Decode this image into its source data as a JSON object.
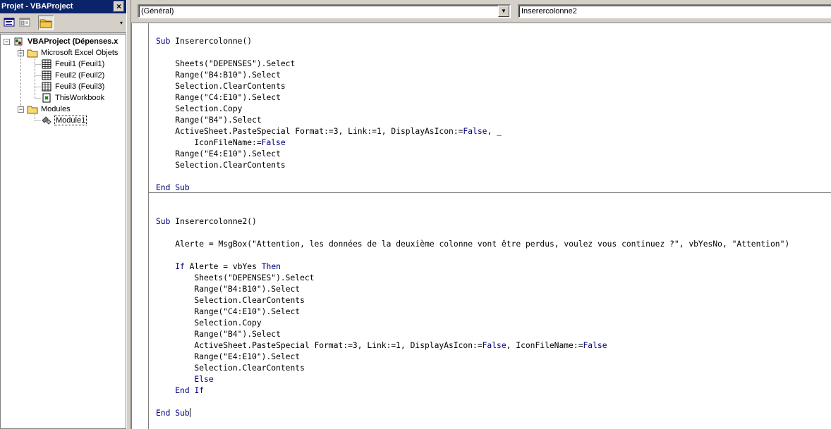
{
  "project_panel": {
    "title": "Projet - VBAProject",
    "close_glyph": "×",
    "toolbar": {
      "view_code_icon": "view-code-icon",
      "view_object_icon": "view-object-icon",
      "toggle_folders_icon": "folder-icon"
    },
    "tree": {
      "root": "VBAProject (Dépenses.x",
      "folders": [
        {
          "label": "Microsoft Excel Objets",
          "items": [
            "Feuil1 (Feuil1)",
            "Feuil2 (Feuil2)",
            "Feuil3 (Feuil3)",
            "ThisWorkbook"
          ]
        },
        {
          "label": "Modules",
          "items": [
            "Module1"
          ]
        }
      ]
    }
  },
  "code_window": {
    "object_combo": "(Général)",
    "procedure_combo": "Inserercolonne2",
    "lines": [
      "Sub Inserercolonne()",
      "",
      "    Sheets(\"DEPENSES\").Select",
      "    Range(\"B4:B10\").Select",
      "    Selection.ClearContents",
      "    Range(\"C4:E10\").Select",
      "    Selection.Copy",
      "    Range(\"B4\").Select",
      "    ActiveSheet.PasteSpecial Format:=3, Link:=1, DisplayAsIcon:=False, _",
      "        IconFileName:=False",
      "    Range(\"E4:E10\").Select",
      "    Selection.ClearContents",
      "",
      "End Sub",
      "",
      "",
      "Sub Inserercolonne2()",
      "",
      "    Alerte = MsgBox(\"Attention, les données de la deuxième colonne vont être perdus, voulez vous continuez ?\", vbYesNo, \"Attention\")",
      "",
      "    If Alerte = vbYes Then",
      "        Sheets(\"DEPENSES\").Select",
      "        Range(\"B4:B10\").Select",
      "        Selection.ClearContents",
      "        Range(\"C4:E10\").Select",
      "        Selection.Copy",
      "        Range(\"B4\").Select",
      "        ActiveSheet.PasteSpecial Format:=3, Link:=1, DisplayAsIcon:=False, IconFileName:=False",
      "        Range(\"E4:E10\").Select",
      "        Selection.ClearContents",
      "        Else",
      "    End If",
      "",
      "End Sub"
    ],
    "keywords": [
      "Sub",
      "End",
      "False",
      "If",
      "Then",
      "Else"
    ],
    "colors": {
      "keyword": "#000080",
      "text": "#000000",
      "title_bar": "#0a246a"
    }
  }
}
